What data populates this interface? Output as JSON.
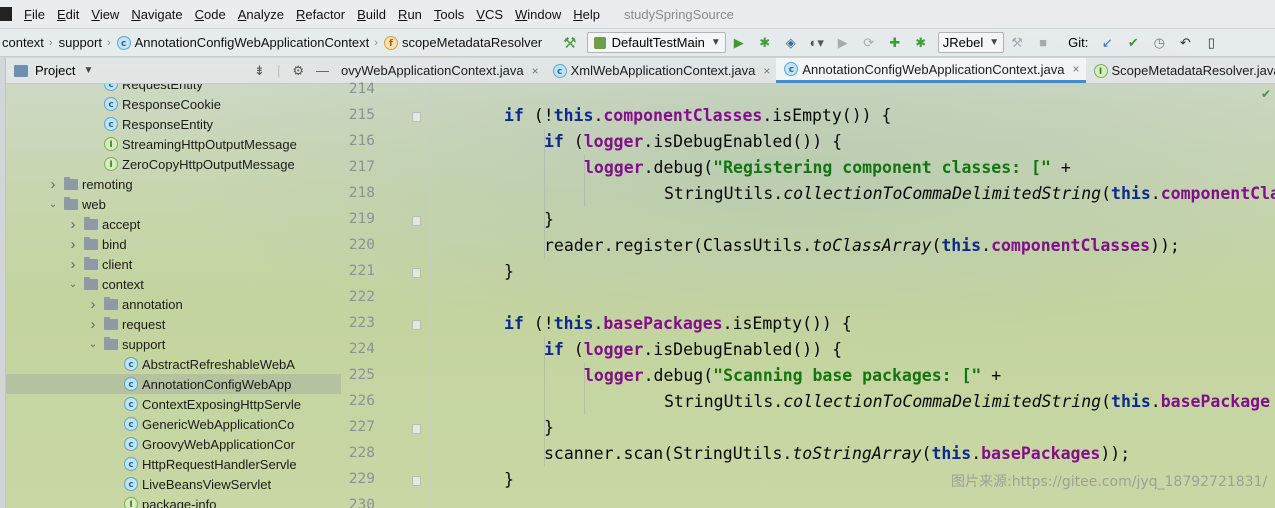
{
  "menubar": {
    "items": [
      "File",
      "Edit",
      "View",
      "Navigate",
      "Code",
      "Analyze",
      "Refactor",
      "Build",
      "Run",
      "Tools",
      "VCS",
      "Window",
      "Help"
    ],
    "project_name": "studySpringSource"
  },
  "navbar": {
    "crumbs": [
      "context",
      "support",
      "AnnotationConfigWebApplicationContext",
      "scopeMetadataResolver"
    ],
    "run_config": "DefaultTestMain",
    "jrebel": "JRebel",
    "git_label": "Git:"
  },
  "project_panel": {
    "title": "Project",
    "tree": [
      {
        "label": "RequestEntity",
        "icon": "class"
      },
      {
        "label": "ResponseCookie",
        "icon": "class"
      },
      {
        "label": "ResponseEntity",
        "icon": "class"
      },
      {
        "label": "StreamingHttpOutputMessage",
        "icon": "interface"
      },
      {
        "label": "ZeroCopyHttpOutputMessage",
        "icon": "interface"
      },
      {
        "label": "remoting",
        "icon": "folder",
        "expand": "collapsed"
      },
      {
        "label": "web",
        "icon": "folder",
        "expand": "expanded"
      },
      {
        "label": "accept",
        "icon": "folder",
        "expand": "collapsed"
      },
      {
        "label": "bind",
        "icon": "folder",
        "expand": "collapsed"
      },
      {
        "label": "client",
        "icon": "folder",
        "expand": "collapsed"
      },
      {
        "label": "context",
        "icon": "folder",
        "expand": "expanded"
      },
      {
        "label": "annotation",
        "icon": "folder",
        "expand": "collapsed"
      },
      {
        "label": "request",
        "icon": "folder",
        "expand": "collapsed"
      },
      {
        "label": "support",
        "icon": "folder",
        "expand": "expanded"
      },
      {
        "label": "AbstractRefreshableWebA",
        "icon": "class"
      },
      {
        "label": "AnnotationConfigWebApp",
        "icon": "class",
        "selected": true
      },
      {
        "label": "ContextExposingHttpServle",
        "icon": "class"
      },
      {
        "label": "GenericWebApplicationCo",
        "icon": "class"
      },
      {
        "label": "GroovyWebApplicationCor",
        "icon": "class"
      },
      {
        "label": "HttpRequestHandlerServle",
        "icon": "class"
      },
      {
        "label": "LiveBeansViewServlet",
        "icon": "class"
      },
      {
        "label": "package-info",
        "icon": "interface"
      }
    ]
  },
  "editor": {
    "tabs": [
      {
        "label": "ovyWebApplicationContext.java",
        "icon": "class"
      },
      {
        "label": "XmlWebApplicationContext.java",
        "icon": "class"
      },
      {
        "label": "AnnotationConfigWebApplicationContext.java",
        "icon": "class",
        "active": true
      },
      {
        "label": "ScopeMetadataResolver.java",
        "icon": "interface"
      }
    ],
    "line_numbers": [
      "214",
      "215",
      "216",
      "217",
      "218",
      "219",
      "220",
      "221",
      "222",
      "223",
      "224",
      "225",
      "226",
      "227",
      "228",
      "229",
      "230"
    ],
    "lines": [
      [],
      [
        {
          "t": "if",
          "c": "kw"
        },
        {
          "t": " (!"
        },
        {
          "t": "this",
          "c": "kw"
        },
        {
          "t": "."
        },
        {
          "t": "componentClasses",
          "c": "fld"
        },
        {
          "t": ".isEmpty()) {"
        }
      ],
      [
        {
          "t": "if",
          "c": "kw"
        },
        {
          "t": " ("
        },
        {
          "t": "logger",
          "c": "fld"
        },
        {
          "t": ".isDebugEnabled()) {"
        }
      ],
      [
        {
          "t": "logger",
          "c": "fld"
        },
        {
          "t": ".debug("
        },
        {
          "t": "\"Registering component classes: [\"",
          "c": "str"
        },
        {
          "t": " +"
        }
      ],
      [
        {
          "t": "StringUtils."
        },
        {
          "t": "collectionToCommaDelimitedString",
          "c": "stat"
        },
        {
          "t": "("
        },
        {
          "t": "this",
          "c": "kw"
        },
        {
          "t": "."
        },
        {
          "t": "componentCla",
          "c": "fld"
        }
      ],
      [
        {
          "t": "}"
        }
      ],
      [
        {
          "t": "reader.register(ClassUtils."
        },
        {
          "t": "toClassArray",
          "c": "stat"
        },
        {
          "t": "("
        },
        {
          "t": "this",
          "c": "kw"
        },
        {
          "t": "."
        },
        {
          "t": "componentClasses",
          "c": "fld"
        },
        {
          "t": "));"
        }
      ],
      [
        {
          "t": "}"
        }
      ],
      [],
      [
        {
          "t": "if",
          "c": "kw"
        },
        {
          "t": " (!"
        },
        {
          "t": "this",
          "c": "kw"
        },
        {
          "t": "."
        },
        {
          "t": "basePackages",
          "c": "fld"
        },
        {
          "t": ".isEmpty()) {"
        }
      ],
      [
        {
          "t": "if",
          "c": "kw"
        },
        {
          "t": " ("
        },
        {
          "t": "logger",
          "c": "fld"
        },
        {
          "t": ".isDebugEnabled()) {"
        }
      ],
      [
        {
          "t": "logger",
          "c": "fld"
        },
        {
          "t": ".debug("
        },
        {
          "t": "\"Scanning base packages: [\"",
          "c": "str"
        },
        {
          "t": " +"
        }
      ],
      [
        {
          "t": "StringUtils."
        },
        {
          "t": "collectionToCommaDelimitedString",
          "c": "stat"
        },
        {
          "t": "("
        },
        {
          "t": "this",
          "c": "kw"
        },
        {
          "t": "."
        },
        {
          "t": "basePackage",
          "c": "fld"
        }
      ],
      [
        {
          "t": "}"
        }
      ],
      [
        {
          "t": "scanner.scan(StringUtils."
        },
        {
          "t": "toStringArray",
          "c": "stat"
        },
        {
          "t": "("
        },
        {
          "t": "this",
          "c": "kw"
        },
        {
          "t": "."
        },
        {
          "t": "basePackages",
          "c": "fld"
        },
        {
          "t": "));"
        }
      ],
      [
        {
          "t": "}"
        }
      ],
      []
    ]
  },
  "watermark": "图片来源:https://gitee.com/jyq_18792721831/"
}
